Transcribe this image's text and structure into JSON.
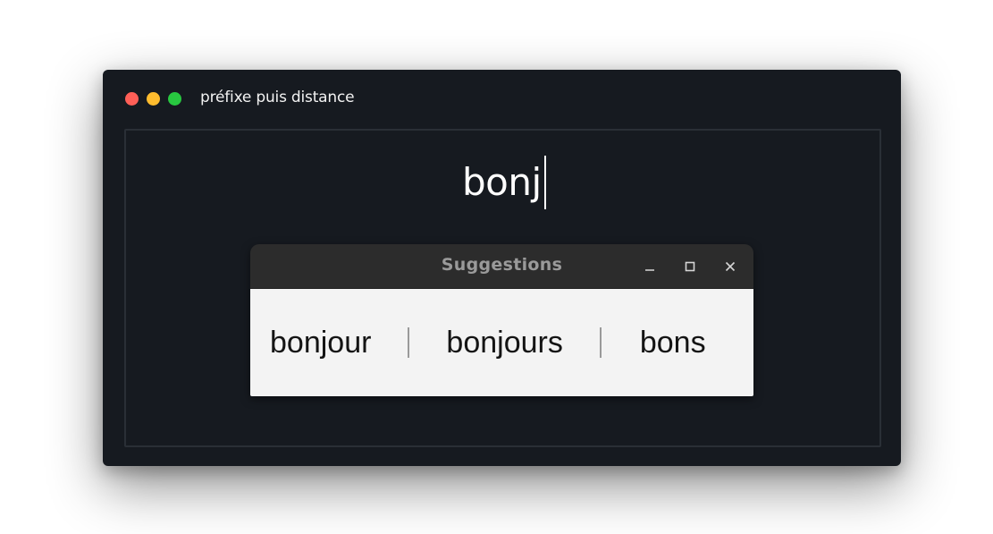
{
  "window": {
    "title": "préfixe puis distance",
    "traffic_lights": [
      {
        "name": "close",
        "color": "#ff5f57"
      },
      {
        "name": "minimize",
        "color": "#febc2e"
      },
      {
        "name": "zoom",
        "color": "#28c840"
      }
    ]
  },
  "editor": {
    "typed_text": "bonj"
  },
  "suggestions_popup": {
    "title": "Suggestions",
    "controls": {
      "minimize_icon": "minimize-icon",
      "maximize_icon": "maximize-icon",
      "close_icon": "close-icon"
    },
    "items": [
      "bonjour",
      "bonjours",
      "bons"
    ]
  },
  "colors": {
    "window_background": "#161a20",
    "popup_titlebar": "#2c2c2c",
    "popup_body": "#f3f3f3",
    "separator": "#9a9a9a"
  }
}
